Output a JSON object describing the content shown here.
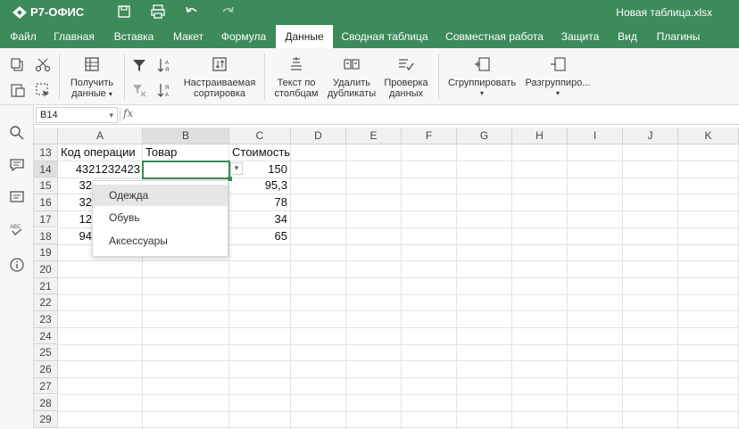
{
  "app": {
    "logo_text": "Р7-ОФИС",
    "doc_title": "Новая таблица.xlsx"
  },
  "menu": {
    "tabs": [
      "Файл",
      "Главная",
      "Вставка",
      "Макет",
      "Формула",
      "Данные",
      "Сводная таблица",
      "Совместная работа",
      "Защита",
      "Вид",
      "Плагины"
    ],
    "active": "Данные"
  },
  "toolbar": {
    "get_data_l1": "Получить",
    "get_data_l2": "данные",
    "custom_sort_l1": "Настраиваемая",
    "custom_sort_l2": "сортировка",
    "text_to_cols_l1": "Текст по",
    "text_to_cols_l2": "столбцам",
    "remove_dup_l1": "Удалить",
    "remove_dup_l2": "дубликаты",
    "validation_l1": "Проверка",
    "validation_l2": "данных",
    "group": "Сгруппировать",
    "ungroup": "Разгруппиро..."
  },
  "formula_bar": {
    "cell_ref": "B14",
    "fx_label": "fx",
    "formula": ""
  },
  "grid": {
    "columns": [
      "A",
      "B",
      "C",
      "D",
      "E",
      "F",
      "G",
      "H",
      "I",
      "J",
      "K"
    ],
    "selected_column": "B",
    "rows": [
      "13",
      "14",
      "15",
      "16",
      "17",
      "18",
      "19",
      "20",
      "21",
      "22",
      "23",
      "24",
      "25",
      "26",
      "27",
      "28",
      "29"
    ],
    "selected_row": "14",
    "header_row": {
      "a": "Код операции",
      "b": "Товар",
      "c": "Стоимость"
    },
    "data": [
      {
        "a": "4321232423",
        "c": "150"
      },
      {
        "a": "32",
        "c": "95,3"
      },
      {
        "a": "32",
        "c": "78"
      },
      {
        "a": "12",
        "c": "34"
      },
      {
        "a": "94",
        "c": "65"
      }
    ]
  },
  "dropdown": {
    "items": [
      "Одежда",
      "Обувь",
      "Аксессуары"
    ],
    "highlighted": "Одежда"
  },
  "colors": {
    "brand_green": "#3d8a5a",
    "header_bg": "#f1f1f1"
  }
}
